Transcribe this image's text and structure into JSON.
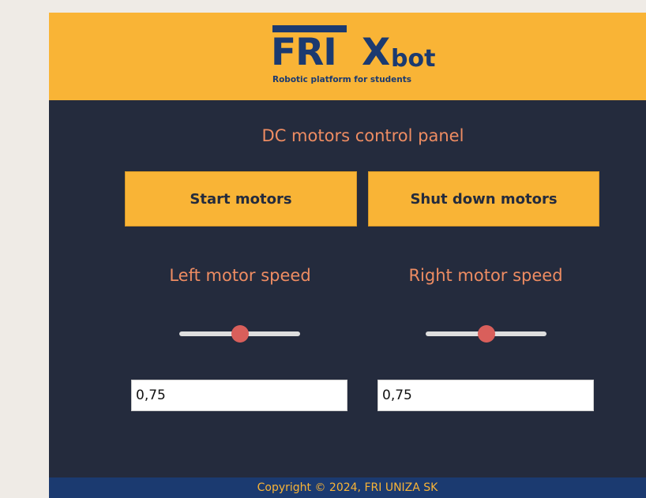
{
  "header": {
    "logo": {
      "brand_main": "FRI",
      "brand_x": "X",
      "brand_bot": "bot",
      "tagline": "Robotic platform for students"
    }
  },
  "panel": {
    "title": "DC motors control panel",
    "start_button": "Start motors",
    "shutdown_button": "Shut down motors"
  },
  "motors": {
    "left": {
      "label": "Left motor speed",
      "value": "0,75",
      "slider_level": 0.5
    },
    "right": {
      "label": "Right motor speed",
      "value": "0,75",
      "slider_level": 0.5
    }
  },
  "footer": {
    "text": "Copyright © 2024, FRI UNIZA SK"
  },
  "colors": {
    "accent": "#f9b436",
    "navy": "#1b3a70",
    "panel_bg": "#242b3d",
    "label": "#ee8c62",
    "slider_thumb": "#d95f5b"
  }
}
